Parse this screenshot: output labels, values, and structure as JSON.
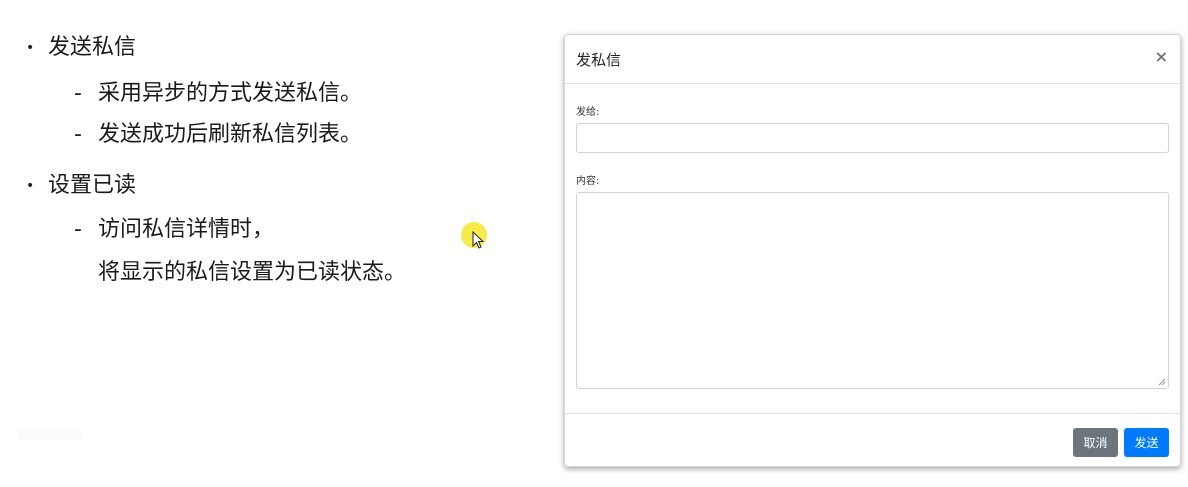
{
  "slide": {
    "bullets": [
      {
        "label": "发送私信",
        "subs": [
          "采用异步的方式发送私信。",
          "发送成功后刷新私信列表。"
        ]
      },
      {
        "label": "设置已读",
        "subs": [
          "访问私信详情时，"
        ],
        "continuation": "将显示的私信设置为已读状态。"
      }
    ],
    "bullet_glyph": "•",
    "dash_glyph": "-"
  },
  "modal": {
    "title": "发私信",
    "close_glyph": "×",
    "to_label": "发给:",
    "to_value": "",
    "content_label": "内容:",
    "content_value": "",
    "cancel_label": "取消",
    "send_label": "发送"
  },
  "colors": {
    "cursor_highlight": "#f5e828",
    "cancel_button": "#6c757d",
    "send_button": "#007bff"
  }
}
